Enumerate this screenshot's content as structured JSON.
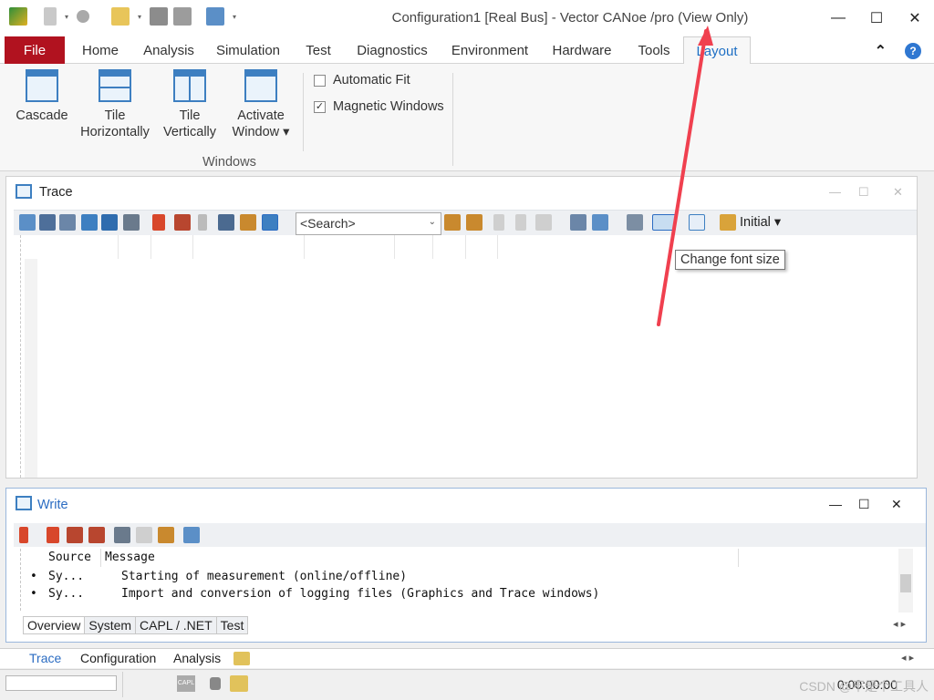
{
  "window": {
    "title": "Configuration1 [Real Bus] - Vector CANoe /pro (View Only)",
    "controls": {
      "minimize": "—",
      "maximize": "☐",
      "close": "✕"
    }
  },
  "ribbon": {
    "tabs": [
      "File",
      "Home",
      "Analysis",
      "Simulation",
      "Test",
      "Diagnostics",
      "Environment",
      "Hardware",
      "Tools",
      "Layout"
    ],
    "active_tab": "Layout",
    "collapse_glyph": "⌃",
    "help_glyph": "?",
    "buttons": {
      "cascade": "Cascade",
      "tile_h_1": "Tile",
      "tile_h_2": "Horizontally",
      "tile_v_1": "Tile",
      "tile_v_2": "Vertically",
      "activate_1": "Activate",
      "activate_2": "Window ▾"
    },
    "checkboxes": [
      {
        "label": "Automatic Fit",
        "checked": false,
        "mark": ""
      },
      {
        "label": "Magnetic Windows",
        "checked": true,
        "mark": "✓"
      }
    ],
    "group_label": "Windows"
  },
  "trace": {
    "title": "Trace",
    "search_placeholder": "<Search>",
    "search_arrow": "⌄",
    "initial_label": "Initial ▾",
    "tooltip": "Change font size"
  },
  "write": {
    "title": "Write",
    "columns": {
      "source": "Source",
      "message": "Message"
    },
    "rows": [
      {
        "bullet": "•",
        "source": "Sy...",
        "message": "Starting of measurement (online/offline)"
      },
      {
        "bullet": "•",
        "source": "Sy...",
        "message": "Import and conversion of logging files (Graphics and Trace windows)"
      }
    ],
    "tabs": [
      "Overview",
      "System",
      "CAPL / .NET",
      "Test"
    ],
    "active_tab": "Overview"
  },
  "desktop_tabs": [
    "Trace",
    "Configuration",
    "Analysis"
  ],
  "desktop_active": "Trace",
  "status": {
    "time": "0:00:00:00",
    "capl_icon_label": "CAPL"
  },
  "watermark": "CSDN @不是个工具人",
  "colors": {
    "file_tab": "#b1121f",
    "accent": "#2b6cc2",
    "arrow": "#f0404f"
  }
}
